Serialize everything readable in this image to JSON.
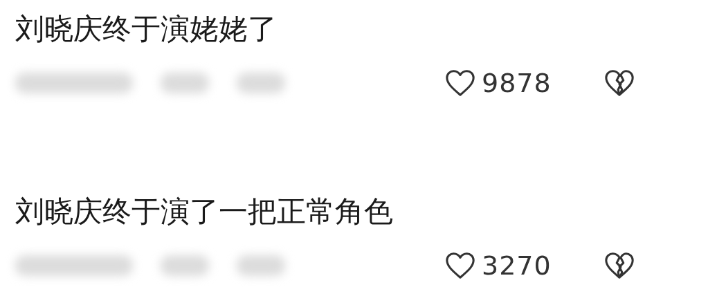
{
  "comments": [
    {
      "text": "刘晓庆终于演姥姥了",
      "likes": "9878"
    },
    {
      "text": "刘晓庆终于演了一把正常角色",
      "likes": "3270"
    }
  ]
}
